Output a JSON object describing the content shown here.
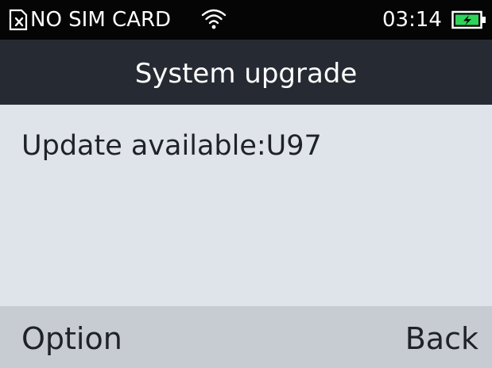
{
  "status_bar": {
    "carrier": "NO SIM CARD",
    "time": "03:14",
    "sim_icon": "no-sim-icon",
    "wifi_icon": "wifi-icon",
    "battery_icon": "battery-charging-icon",
    "battery_color": "#2fd35a"
  },
  "header": {
    "title": "System upgrade"
  },
  "content": {
    "message": "Update available:U97"
  },
  "softkeys": {
    "left_label": "Option",
    "right_label": "Back"
  },
  "colors": {
    "status_bar_bg": "#050505",
    "title_bar_bg": "#262b33",
    "content_bg": "#dfe3ea",
    "softkey_bg": "#c7cbd2"
  }
}
